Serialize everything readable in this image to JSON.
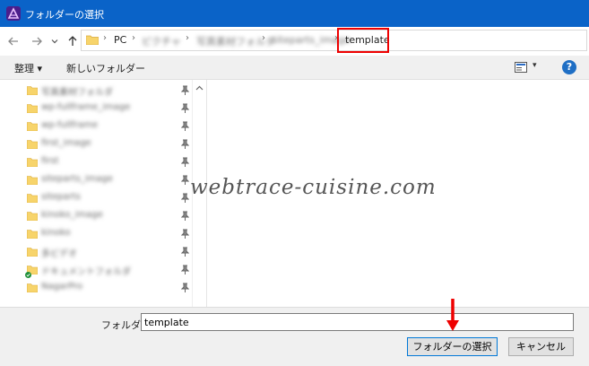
{
  "window": {
    "title": "フォルダーの選択",
    "icon": "affinity-app-icon"
  },
  "nav": {
    "back_icon": "arrow-left-icon",
    "forward_icon": "arrow-right-icon",
    "history_icon": "chevron-down-icon",
    "up_icon": "arrow-up-icon"
  },
  "address": {
    "crumbs": [
      "PC",
      "ピクチャ",
      "写真素材フォルダ",
      "siteparts_image",
      "template"
    ]
  },
  "toolbar": {
    "organize": "整理 ▾",
    "new_folder": "新しいフォルダー",
    "view_menu": "▾",
    "help": "?"
  },
  "tree": {
    "items": [
      {
        "label": "写真素材フォルダ"
      },
      {
        "label": "wp-fullframe_image"
      },
      {
        "label": "wp-fullframe"
      },
      {
        "label": "first_image"
      },
      {
        "label": "first"
      },
      {
        "label": "siteparts_image"
      },
      {
        "label": "siteparts"
      },
      {
        "label": "kinoko_image"
      },
      {
        "label": "kinoko"
      },
      {
        "label": "多ビデオ"
      },
      {
        "label": "ドキュメントフォルダ"
      },
      {
        "label": "NagarPro"
      }
    ]
  },
  "watermark": "webtrace-cuisine.com",
  "bottom": {
    "folder_label": "フォルダー:",
    "folder_value": "template",
    "select_button": "フォルダーの選択",
    "cancel_button": "キャンセル"
  },
  "colors": {
    "titlebar": "#0a63c8",
    "highlight": "#e00000",
    "folder": "#f7d46b"
  }
}
